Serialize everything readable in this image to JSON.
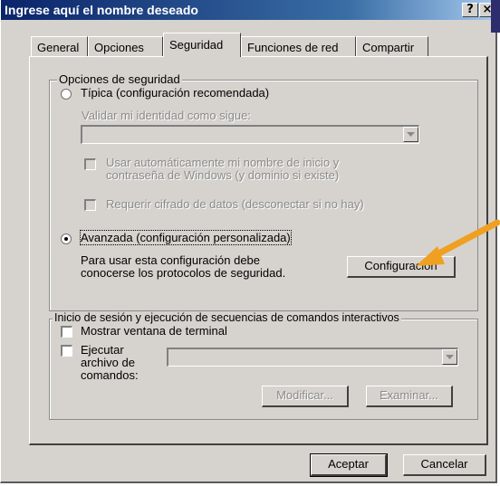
{
  "window": {
    "title": "Ingrese aquí el nombre deseado",
    "help_label": "?",
    "close_label": "×"
  },
  "tabs": [
    {
      "label": "General"
    },
    {
      "label": "Opciones"
    },
    {
      "label": "Seguridad",
      "active": true
    },
    {
      "label": "Funciones de red"
    },
    {
      "label": "Compartir"
    }
  ],
  "security_options": {
    "legend": "Opciones de seguridad",
    "typical_label": "Típica (configuración recomendada)",
    "typical_selected": false,
    "validate_label": "Validar mi identidad como sigue:",
    "validate_value": "",
    "auto_login_label_1": "Usar automáticamente  mi nombre de inicio y",
    "auto_login_label_2": "contraseña de Windows (y dominio si existe)",
    "require_encryption_label": "Requerir cifrado de datos (desconectar si no hay)",
    "advanced_label": "Avanzada (configuración personalizada)",
    "advanced_selected": true,
    "advanced_desc_1": "Para usar esta configuración debe",
    "advanced_desc_2": "conocerse los protocolos de seguridad.",
    "settings_button": "Configuración"
  },
  "interactive": {
    "legend": "Inicio de sesión y ejecución de secuencias de comandos interactivos",
    "show_terminal_label": "Mostrar ventana de terminal",
    "run_script_label_1": "Ejecutar",
    "run_script_label_2": "archivo de",
    "run_script_label_3": "comandos:",
    "script_value": "",
    "modify_button": "Modificar...",
    "browse_button": "Examinar..."
  },
  "footer": {
    "ok_button": "Aceptar",
    "cancel_button": "Cancelar"
  },
  "colors": {
    "dialog_bg": "#d6d3ce",
    "title_start": "#0a246a",
    "title_end": "#a6caf0",
    "annotation_arrow": "#f0a020"
  }
}
